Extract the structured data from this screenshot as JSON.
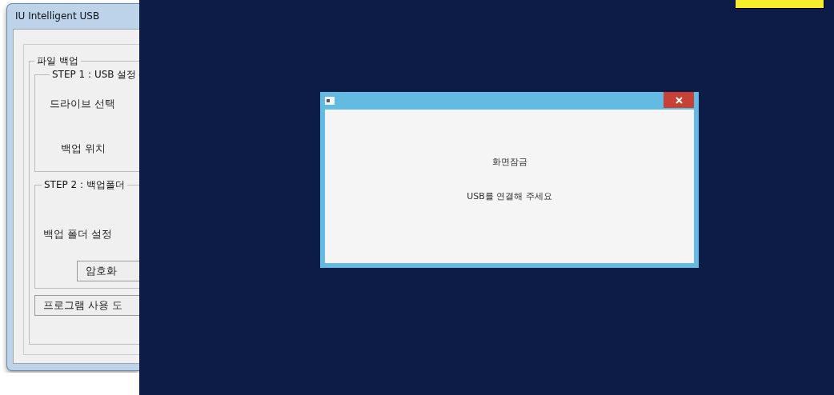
{
  "left_window": {
    "title": "IU  Intelligent USB",
    "group": "파일 백업",
    "step1": {
      "legend": "STEP 1 : USB 설정",
      "rows": [
        "드라이브 선택",
        "백업 위치"
      ]
    },
    "step2": {
      "legend": "STEP 2 : 백업폴더",
      "row": "백업 폴더 설정",
      "button": "암호화"
    },
    "help_button": "프로그램 사용 도"
  },
  "dialog": {
    "lines": [
      "화면잠금",
      "USB를 연결해 주세요"
    ]
  }
}
